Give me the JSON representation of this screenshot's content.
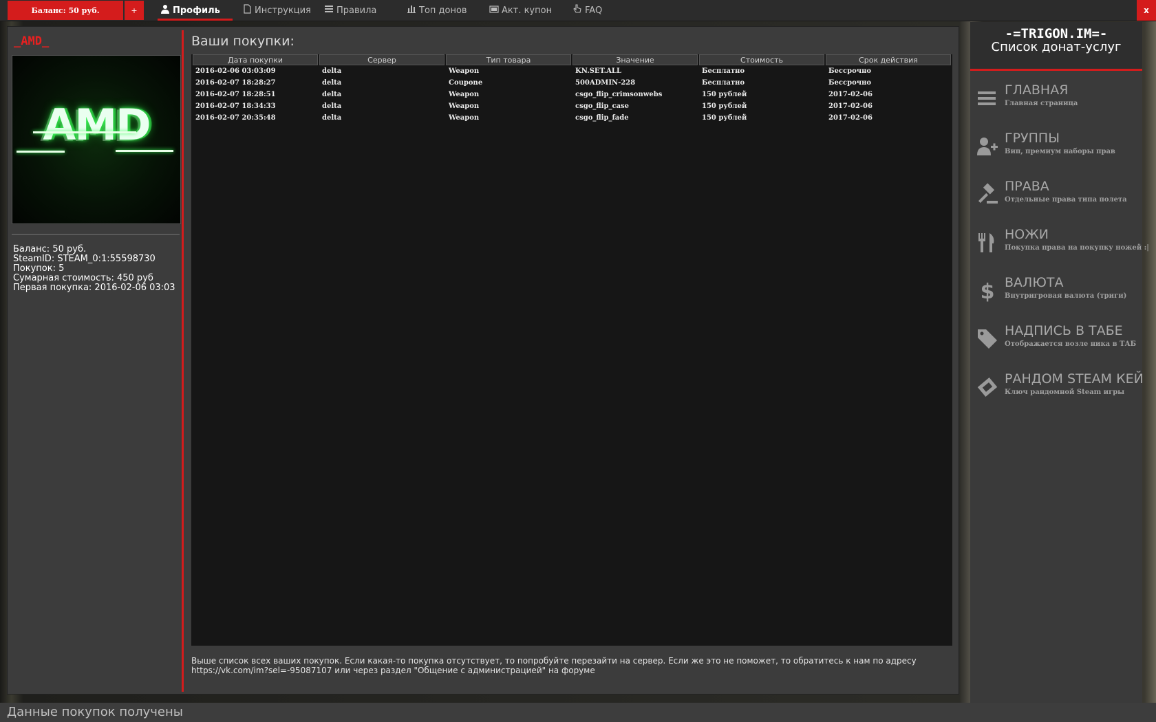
{
  "topbar": {
    "balance_label": "Баланс: 50 руб.",
    "plus_label": "+",
    "nav": [
      {
        "label": "Профиль",
        "icon": "user-icon",
        "active": true
      },
      {
        "label": "Инструкция",
        "icon": "document-icon"
      },
      {
        "label": "Правила",
        "icon": "list-icon"
      },
      {
        "label": "Топ донов",
        "icon": "bar-chart-icon"
      },
      {
        "label": "Акт. купон",
        "icon": "ticket-icon"
      },
      {
        "label": "FAQ",
        "icon": "hand-pointer-icon"
      }
    ],
    "close_label": "x"
  },
  "profile": {
    "username": "_AMD_",
    "avatar_text": "AMD",
    "stats": [
      "Баланс: 50 руб.",
      "SteamID: STEAM_0:1:55598730",
      "Покупок: 5",
      "Сумарная стоимость: 450 руб",
      "Первая покупка: 2016-02-06 03:03"
    ]
  },
  "purchases": {
    "title": "Ваши покупки:",
    "columns": [
      "Дата покупки",
      "Сервер",
      "Тип товара",
      "Значение",
      "Стоимость",
      "Срок действия"
    ],
    "rows": [
      [
        "2016-02-06 03:03:09",
        "delta",
        "Weapon",
        "KN.SET.ALL",
        "Бесплатно",
        "Бессрочно"
      ],
      [
        "2016-02-07 18:28:27",
        "delta",
        "Coupone",
        "500ADMIN-228",
        "Бесплатно",
        "Бессрочно"
      ],
      [
        "2016-02-07 18:28:51",
        "delta",
        "Weapon",
        "csgo_flip_crimsonwebs",
        "150 рублей",
        "2017-02-06"
      ],
      [
        "2016-02-07 18:34:33",
        "delta",
        "Weapon",
        "csgo_flip_case",
        "150 рублей",
        "2017-02-06"
      ],
      [
        "2016-02-07 20:35:48",
        "delta",
        "Weapon",
        "csgo_flip_fade",
        "150 рублей",
        "2017-02-06"
      ]
    ],
    "note_line1": "Выше список всех ваших покупок. Если какая-то покупка отсутствует, то попробуйте перезайти на сервер. Если же это не поможет, то обратитесь к нам по адресу",
    "note_line2": "https://vk.com/im?sel=-95087107 или через раздел \"Общение с администрацией\" на форуме"
  },
  "sidebar": {
    "brand_line1": "-=TRIGON.IM=-",
    "brand_line2": "Список донат-услуг",
    "items": [
      {
        "label": "ГЛАВНАЯ",
        "sub": "Главная страница",
        "icon": "menu-icon"
      },
      {
        "label": "ГРУППЫ",
        "sub": "Вип, премиум наборы прав",
        "icon": "user-plus-icon"
      },
      {
        "label": "ПРАВА",
        "sub": "Отдельные права типа полета",
        "icon": "gavel-icon"
      },
      {
        "label": "НОЖИ",
        "sub": "Покупка права на покупку ножей :|",
        "icon": "cutlery-icon"
      },
      {
        "label": "ВАЛЮТА",
        "sub": "Внутригровая валюта (триги)",
        "icon": "dollar-icon"
      },
      {
        "label": "НАДПИСЬ В ТАБЕ",
        "sub": "Отображается возле ника в ТАБ",
        "icon": "tag-icon"
      },
      {
        "label": "РАНДОМ STEAM КЕЙ",
        "sub": "Ключ рандомной Steam игры",
        "icon": "ticket-icon"
      }
    ]
  },
  "status": {
    "text": "Данные покупок получены"
  },
  "colors": {
    "accent": "#d41c1c",
    "panel": "#3c3c3c",
    "table_bg": "#161616"
  }
}
